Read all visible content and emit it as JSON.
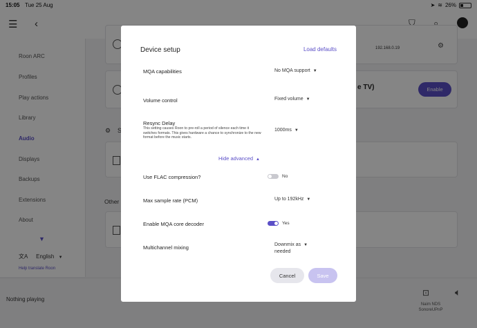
{
  "statusbar": {
    "time": "15:05",
    "date": "Tue 25 Aug",
    "battery": "26%"
  },
  "sidebar": {
    "items": [
      {
        "label": "Roon ARC"
      },
      {
        "label": "Profiles"
      },
      {
        "label": "Play actions"
      },
      {
        "label": "Library"
      },
      {
        "label": "Audio"
      },
      {
        "label": "Displays"
      },
      {
        "label": "Backups"
      },
      {
        "label": "Extensions"
      },
      {
        "label": "About"
      }
    ],
    "active": "Audio",
    "language": "English",
    "help": "Help translate Roon"
  },
  "background": {
    "device_ip": "192.168.0.19",
    "tv_fragment": "e TV)",
    "enable_label": "Enable",
    "section_fragment": "S",
    "other_fragment": "Other"
  },
  "footer": {
    "now_playing": "Nothing playing",
    "zone_name": "Naim NDS",
    "zone_sub": "SonoreUPnP"
  },
  "dialog": {
    "title": "Device setup",
    "load_defaults": "Load defaults",
    "mqa_label": "MQA capabilities",
    "mqa_value": "No MQA support",
    "volume_label": "Volume control",
    "volume_value": "Fixed volume",
    "resync_label": "Resync Delay",
    "resync_desc": "This setting causes Roon to pre-roll a period of silence each time it switches formats. This gives hardware a chance to synchronize to the new format before the music starts.",
    "resync_value": "1000ms",
    "hide_advanced": "Hide advanced",
    "flac_label": "Use FLAC compression?",
    "flac_value": "No",
    "flac_on": false,
    "max_rate_label": "Max sample rate (PCM)",
    "max_rate_value": "Up to 192kHz",
    "mqa_core_label": "Enable MQA core decoder",
    "mqa_core_value": "Yes",
    "mqa_core_on": true,
    "multich_label": "Multichannel mixing",
    "multich_value_1": "Downmix as",
    "multich_value_2": "needed",
    "cancel": "Cancel",
    "save": "Save"
  },
  "colors": {
    "accent": "#5b4fc7",
    "toggle_off": "#c9c9cf"
  }
}
